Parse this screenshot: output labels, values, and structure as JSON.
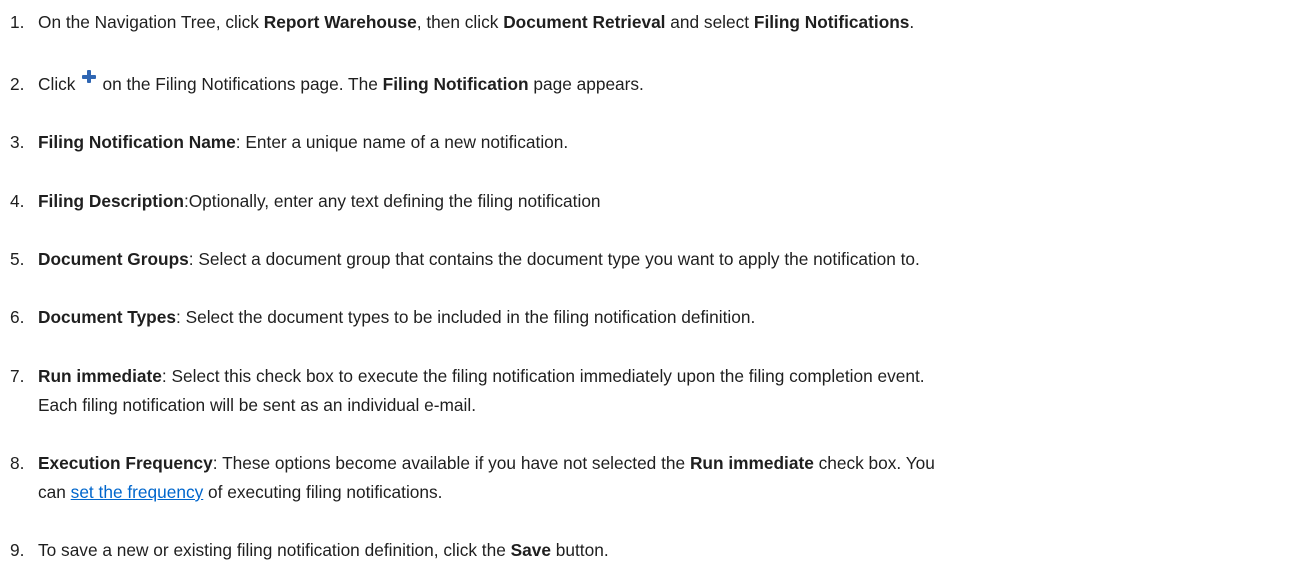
{
  "steps": {
    "s1": {
      "num": "1.",
      "t1": "On the Navigation Tree, click ",
      "b1": "Report Warehouse",
      "t2": ", then click ",
      "b2": "Document Retrieval",
      "t3": " and select ",
      "b3": "Filing Notifications",
      "t4": "."
    },
    "s2": {
      "num": "2.",
      "t1": "Click",
      "icon": "add-icon",
      "t2": "on the Filing Notifications page. The ",
      "b1": "Filing Notification",
      "t3": " page appears."
    },
    "s3": {
      "num": "3.",
      "b1": "Filing Notification Name",
      "t1": ": Enter a unique name of a new notification."
    },
    "s4": {
      "num": "4.",
      "b1": "Filing Description",
      "t1": ":Optionally, enter any text defining the filing notification"
    },
    "s5": {
      "num": "5.",
      "b1": "Document Groups",
      "t1": ": Select a document group that contains the document type you want to apply the notification to."
    },
    "s6": {
      "num": "6.",
      "b1": "Document Types",
      "t1": ": Select the document types to be included in the filing notification definition."
    },
    "s7": {
      "num": "7.",
      "b1": "Run immediate",
      "t1": ": Select this check box to execute the filing notification immediately upon the filing completion event.",
      "t2": "Each filing notification will be sent as an individual e-mail."
    },
    "s8": {
      "num": "8.",
      "b1": "Execution Frequency",
      "t1": ": These options become available if you have not selected the ",
      "b2": "Run immediate",
      "t2": " check box. You",
      "t3": "can ",
      "link": "set the frequency",
      "t4": " of executing filing notifications."
    },
    "s9": {
      "num": "9.",
      "t1": "To save a new or existing filing notification definition, click the ",
      "b1": "Save",
      "t2": " button."
    }
  }
}
